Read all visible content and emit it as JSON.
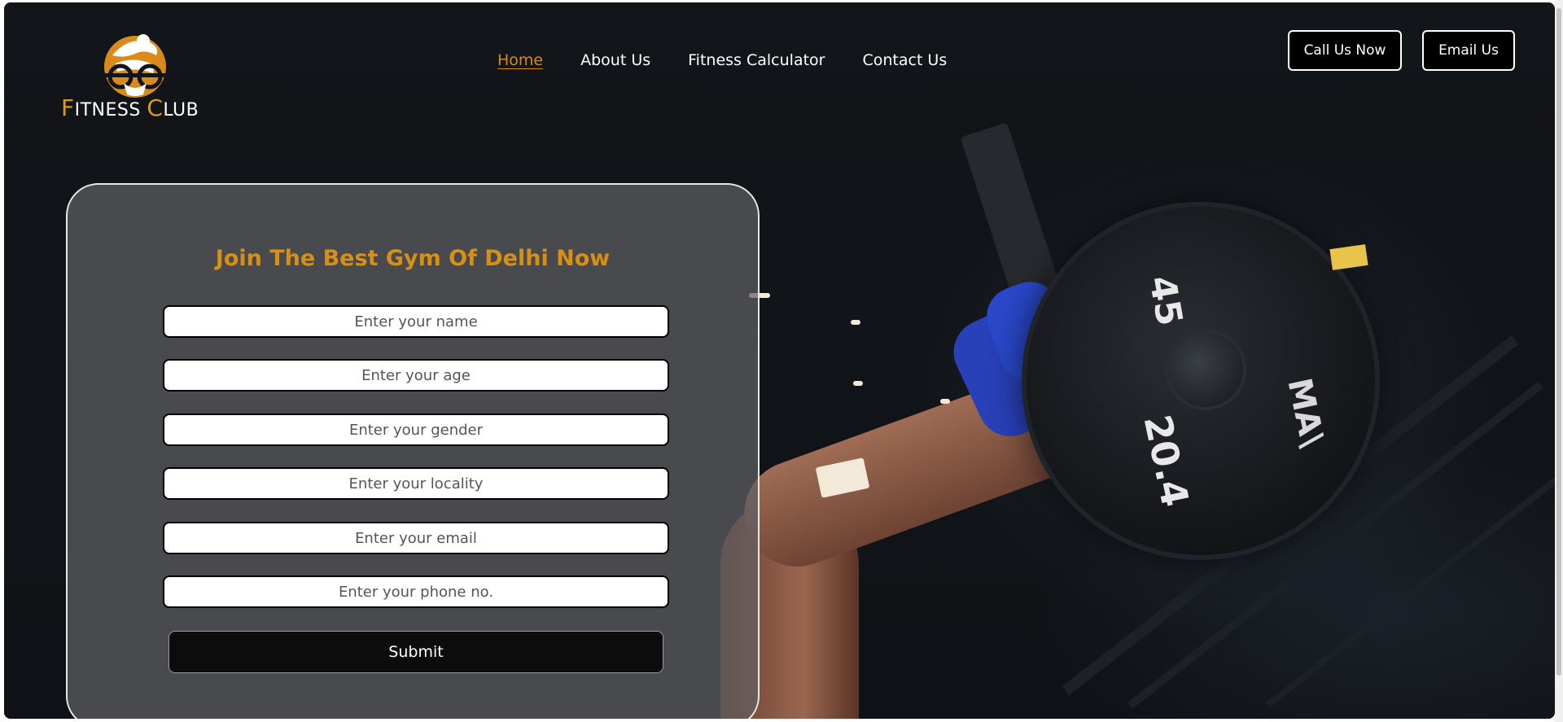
{
  "brand": {
    "word1_initial": "F",
    "word1_rest": "ITNESS",
    "word2_initial": "C",
    "word2_rest": "LUB"
  },
  "nav": {
    "items": [
      {
        "label": "Home",
        "active": true
      },
      {
        "label": "About Us",
        "active": false
      },
      {
        "label": "Fitness Calculator",
        "active": false
      },
      {
        "label": "Contact Us",
        "active": false
      }
    ]
  },
  "header_buttons": {
    "call_label": "Call Us Now",
    "email_label": "Email Us"
  },
  "form": {
    "title": "Join The Best Gym Of Delhi Now",
    "fields": [
      {
        "placeholder": "Enter your name",
        "value": ""
      },
      {
        "placeholder": "Enter your age",
        "value": ""
      },
      {
        "placeholder": "Enter your gender",
        "value": ""
      },
      {
        "placeholder": "Enter your locality",
        "value": ""
      },
      {
        "placeholder": "Enter your email",
        "value": ""
      },
      {
        "placeholder": "Enter your phone no.",
        "value": ""
      }
    ],
    "submit_label": "Submit"
  },
  "background": {
    "plate_number_top": "45",
    "plate_number_bottom": "20.4",
    "plate_brand": "MA\\"
  },
  "colors": {
    "accent": "#d98a1a",
    "title": "#d69018",
    "page_bg": "#111418",
    "button_bg": "#000000"
  },
  "icons": {
    "logo": "barbell-athlete-logo-icon"
  }
}
